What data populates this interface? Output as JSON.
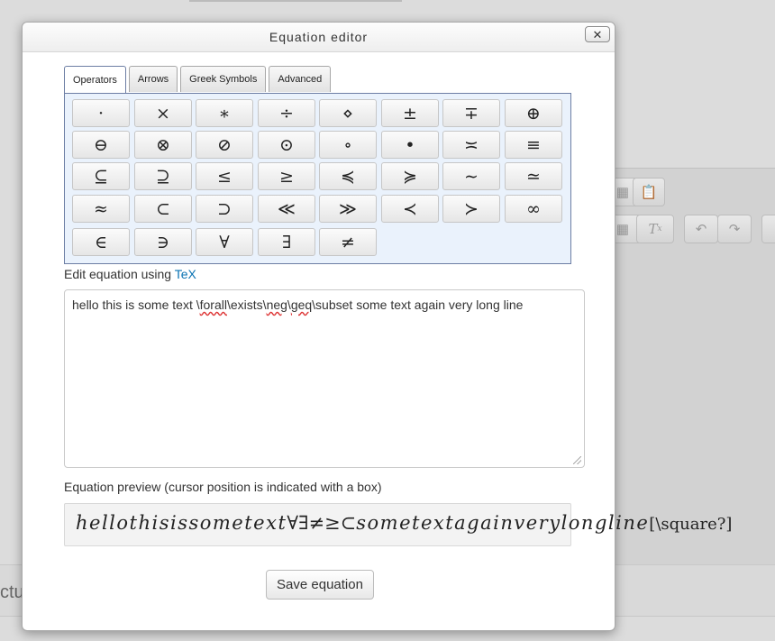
{
  "dialog": {
    "title": "Equation editor",
    "close_glyph": "✕"
  },
  "tabs": [
    {
      "label": "Operators",
      "active": true
    },
    {
      "label": "Arrows",
      "active": false
    },
    {
      "label": "Greek Symbols",
      "active": false
    },
    {
      "label": "Advanced",
      "active": false
    }
  ],
  "symbols": [
    [
      "·",
      "×",
      "∗",
      "÷",
      "⋄",
      "±",
      "∓",
      "⊕"
    ],
    [
      "⊖",
      "⊗",
      "⊘",
      "⊙",
      "∘",
      "•",
      "≍",
      "≡"
    ],
    [
      "⊆",
      "⊇",
      "≤",
      "≥",
      "≼",
      "≽",
      "∼",
      "≃"
    ],
    [
      "≈",
      "⊂",
      "⊃",
      "≪",
      "≫",
      "≺",
      "≻",
      "∞"
    ],
    [
      "∈",
      "∋",
      "∀",
      "∃",
      "≠"
    ]
  ],
  "edit_label": {
    "prefix": "Edit equation using ",
    "link": "TeX"
  },
  "tex_input": {
    "before": "hello this is some text \\",
    "w1": "forall",
    "mid1": "\\exists\\",
    "w2": "neg",
    "mid2": "\\",
    "w3": "geq",
    "after": "\\subset some text again very long line"
  },
  "preview_label": "Equation preview (cursor position is indicated with a box)",
  "preview": {
    "italic_part": "hellothisissometext",
    "symbols_part": "∀∃≠≥⊂",
    "italic_part2": "sometextagainverylongline",
    "tail": "[\\square?]"
  },
  "save_button": "Save equation",
  "background": {
    "partial_text": "ctu"
  }
}
